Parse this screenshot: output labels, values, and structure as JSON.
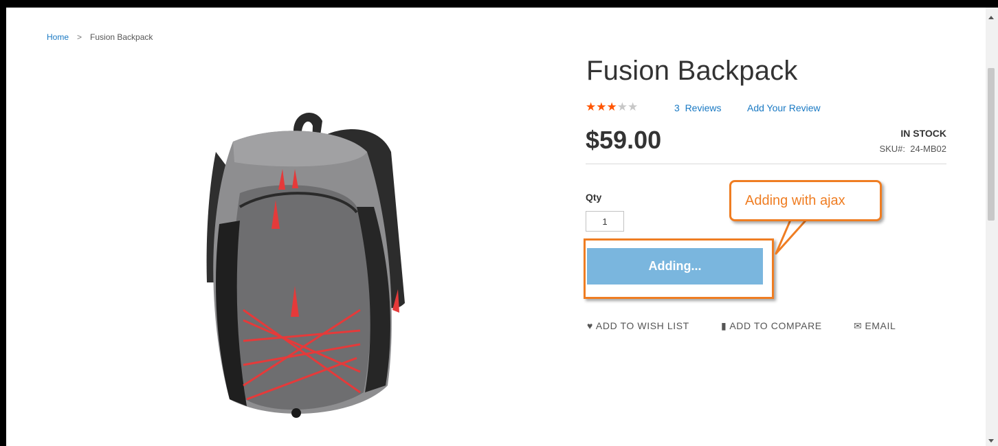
{
  "breadcrumb": {
    "home": "Home",
    "separator": ">",
    "current": "Fusion Backpack"
  },
  "product": {
    "title": "Fusion Backpack",
    "rating": {
      "filled": 3,
      "total": 5,
      "star_color": "#ff5501"
    },
    "reviews_link": "3  Reviews",
    "add_review_link": "Add Your Review",
    "price": "$59.00",
    "stock": "IN STOCK",
    "sku": "SKU#:  24-MB02",
    "image_icon": "backpack-photo"
  },
  "purchase": {
    "qty_label": "Qty",
    "qty_value": "1",
    "button_label": "Adding...",
    "button_color": "#7ab6de"
  },
  "annotation": {
    "callout_text": "Adding with ajax",
    "accent_color": "#ef7d22"
  },
  "actions": {
    "wishlist": {
      "label": "ADD TO WISH LIST",
      "icon": "heart-icon"
    },
    "compare": {
      "label": "ADD TO COMPARE",
      "icon": "bar-chart-icon"
    },
    "email": {
      "label": "EMAIL",
      "icon": "envelope-icon"
    }
  },
  "link_color": "#1979c3"
}
